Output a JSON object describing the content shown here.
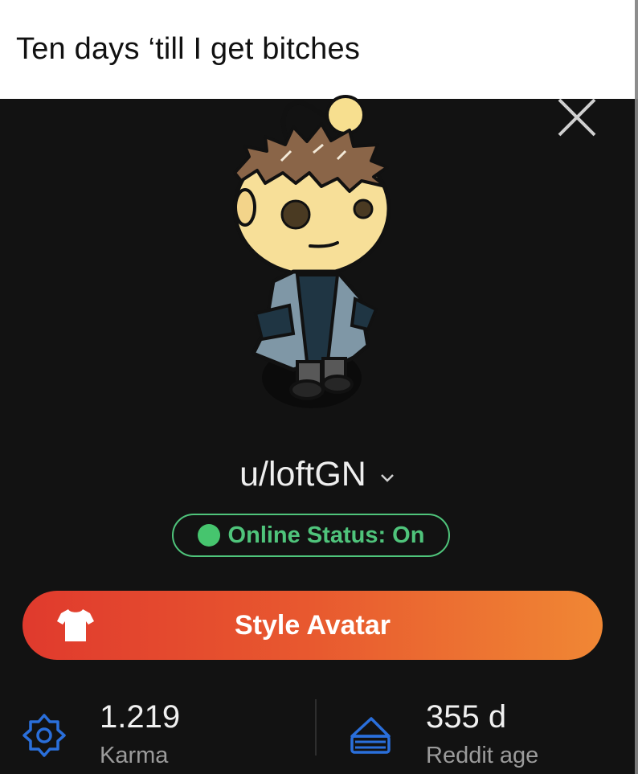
{
  "meme": {
    "caption": "Ten days ‘till I get bitches"
  },
  "profile": {
    "username": "u/loftGN",
    "online_status": "Online Status: On",
    "style_avatar_label": "Style Avatar"
  },
  "stats": {
    "karma": {
      "value": "1.219",
      "label": "Karma",
      "icon": "karma-icon"
    },
    "reddit_age": {
      "value": "355 d",
      "label": "Reddit age",
      "icon": "cake-icon"
    }
  },
  "colors": {
    "background": "#121212",
    "online_green": "#4fc47b",
    "button_gradient_start": "#e03a2d",
    "button_gradient_end": "#f08734",
    "icon_blue": "#2a6fdb"
  }
}
